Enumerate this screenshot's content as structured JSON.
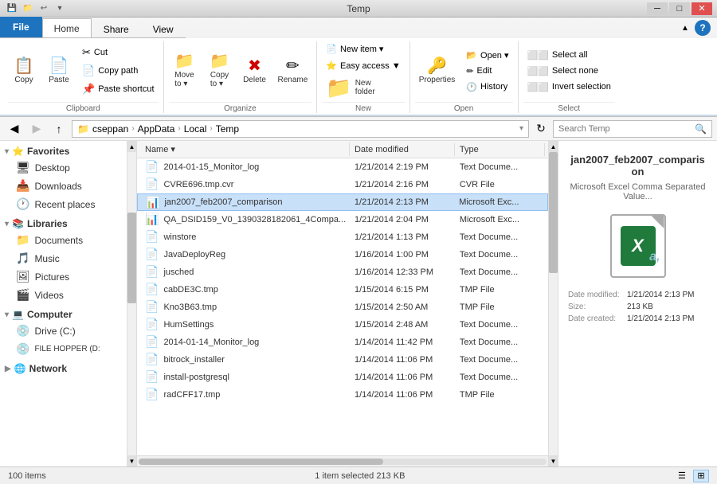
{
  "titlebar": {
    "title": "Temp",
    "minimize": "─",
    "maximize": "□",
    "close": "✕",
    "quickaccess": [
      "💾",
      "📁",
      "↩"
    ]
  },
  "ribbon": {
    "tabs": [
      "File",
      "Home",
      "Share",
      "View"
    ],
    "active_tab": "Home",
    "groups": {
      "clipboard": {
        "label": "Clipboard",
        "buttons": [
          {
            "icon": "📋",
            "label": "Copy"
          },
          {
            "icon": "📄",
            "label": "Paste"
          }
        ],
        "small_buttons": [
          {
            "icon": "✂",
            "label": "Cut"
          },
          {
            "icon": "📄",
            "label": "Copy path"
          },
          {
            "icon": "📌",
            "label": "Paste shortcut"
          }
        ]
      },
      "organize": {
        "label": "Organize",
        "buttons": [
          {
            "icon": "📁",
            "label": "Move to"
          },
          {
            "icon": "📁",
            "label": "Copy to"
          },
          {
            "icon": "✖",
            "label": "Delete"
          },
          {
            "icon": "✏",
            "label": "Rename"
          }
        ]
      },
      "new": {
        "label": "New",
        "buttons": [
          {
            "icon": "📁",
            "label": "New folder"
          }
        ],
        "small_buttons": [
          {
            "icon": "📄",
            "label": "New item ▼"
          }
        ]
      },
      "open": {
        "label": "Open",
        "buttons": [
          {
            "icon": "🔑",
            "label": "Properties"
          }
        ],
        "small_buttons": [
          {
            "icon": "📂",
            "label": "Open ▼"
          },
          {
            "icon": "✏",
            "label": "Edit"
          },
          {
            "icon": "🕐",
            "label": "History"
          }
        ]
      },
      "select": {
        "label": "Select",
        "small_buttons": [
          {
            "icon": "",
            "label": "Select all"
          },
          {
            "icon": "",
            "label": "Select none"
          },
          {
            "icon": "",
            "label": "Invert selection"
          }
        ]
      }
    },
    "easy_access_label": "Easy access ▼"
  },
  "addressbar": {
    "back_disabled": false,
    "forward_disabled": true,
    "up_label": "↑",
    "path_parts": [
      "cseppan",
      "AppData",
      "Local",
      "Temp"
    ],
    "search_placeholder": "Search Temp"
  },
  "navigation": {
    "favorites": {
      "header": "Favorites",
      "items": [
        "Desktop",
        "Downloads",
        "Recent places"
      ]
    },
    "libraries": {
      "header": "Libraries",
      "items": [
        "Documents",
        "Music",
        "Pictures",
        "Videos"
      ]
    },
    "computer": {
      "header": "Computer",
      "items": [
        "Drive (C:)",
        "FILE HOPPER (D:)"
      ]
    },
    "network": {
      "header": "Network"
    }
  },
  "files": {
    "columns": [
      "Name",
      "Date modified",
      "Type"
    ],
    "rows": [
      {
        "name": "2014-01-15_Monitor_log",
        "date": "1/21/2014 2:19 PM",
        "type": "Text Docume...",
        "icon": "📄",
        "selected": false
      },
      {
        "name": "CVRE696.tmp.cvr",
        "date": "1/21/2014 2:16 PM",
        "type": "CVR File",
        "icon": "📄",
        "selected": false
      },
      {
        "name": "jan2007_feb2007_comparison",
        "date": "1/21/2014 2:13 PM",
        "type": "Microsoft Exc...",
        "icon": "📊",
        "selected": true
      },
      {
        "name": "QA_DSID159_V0_1390328182061_4Compa...",
        "date": "1/21/2014 2:04 PM",
        "type": "Microsoft Exc...",
        "icon": "📊",
        "selected": false
      },
      {
        "name": "winstore",
        "date": "1/21/2014 1:13 PM",
        "type": "Text Docume...",
        "icon": "📄",
        "selected": false
      },
      {
        "name": "JavaDeployReg",
        "date": "1/16/2014 1:00 PM",
        "type": "Text Docume...",
        "icon": "📄",
        "selected": false
      },
      {
        "name": "jusched",
        "date": "1/16/2014 12:33 PM",
        "type": "Text Docume...",
        "icon": "📄",
        "selected": false
      },
      {
        "name": "cabDE3C.tmp",
        "date": "1/15/2014 6:15 PM",
        "type": "TMP File",
        "icon": "📄",
        "selected": false
      },
      {
        "name": "Kno3B63.tmp",
        "date": "1/15/2014 2:50 AM",
        "type": "TMP File",
        "icon": "📄",
        "selected": false
      },
      {
        "name": "HumSettings",
        "date": "1/15/2014 2:48 AM",
        "type": "Text Docume...",
        "icon": "📄",
        "selected": false
      },
      {
        "name": "2014-01-14_Monitor_log",
        "date": "1/14/2014 11:42 PM",
        "type": "Text Docume...",
        "icon": "📄",
        "selected": false
      },
      {
        "name": "bitrock_installer",
        "date": "1/14/2014 11:06 PM",
        "type": "Text Docume...",
        "icon": "📄",
        "selected": false
      },
      {
        "name": "install-postgresql",
        "date": "1/14/2014 11:06 PM",
        "type": "Text Docume...",
        "icon": "📄",
        "selected": false
      },
      {
        "name": "radCFF17.tmp",
        "date": "1/14/2014 11:06 PM",
        "type": "TMP File",
        "icon": "📄",
        "selected": false
      }
    ]
  },
  "preview": {
    "filename": "jan2007_feb2007_comparison",
    "filetype": "Microsoft Excel Comma Separated Value...",
    "meta": {
      "date_modified_label": "Date modified:",
      "date_modified": "1/21/2014 2:13 PM",
      "size_label": "Size:",
      "size": "213 KB",
      "date_created_label": "Date created:",
      "date_created": "1/21/2014 2:13 PM"
    }
  },
  "statusbar": {
    "count": "100 items",
    "selection": "1 item selected  213 KB"
  }
}
